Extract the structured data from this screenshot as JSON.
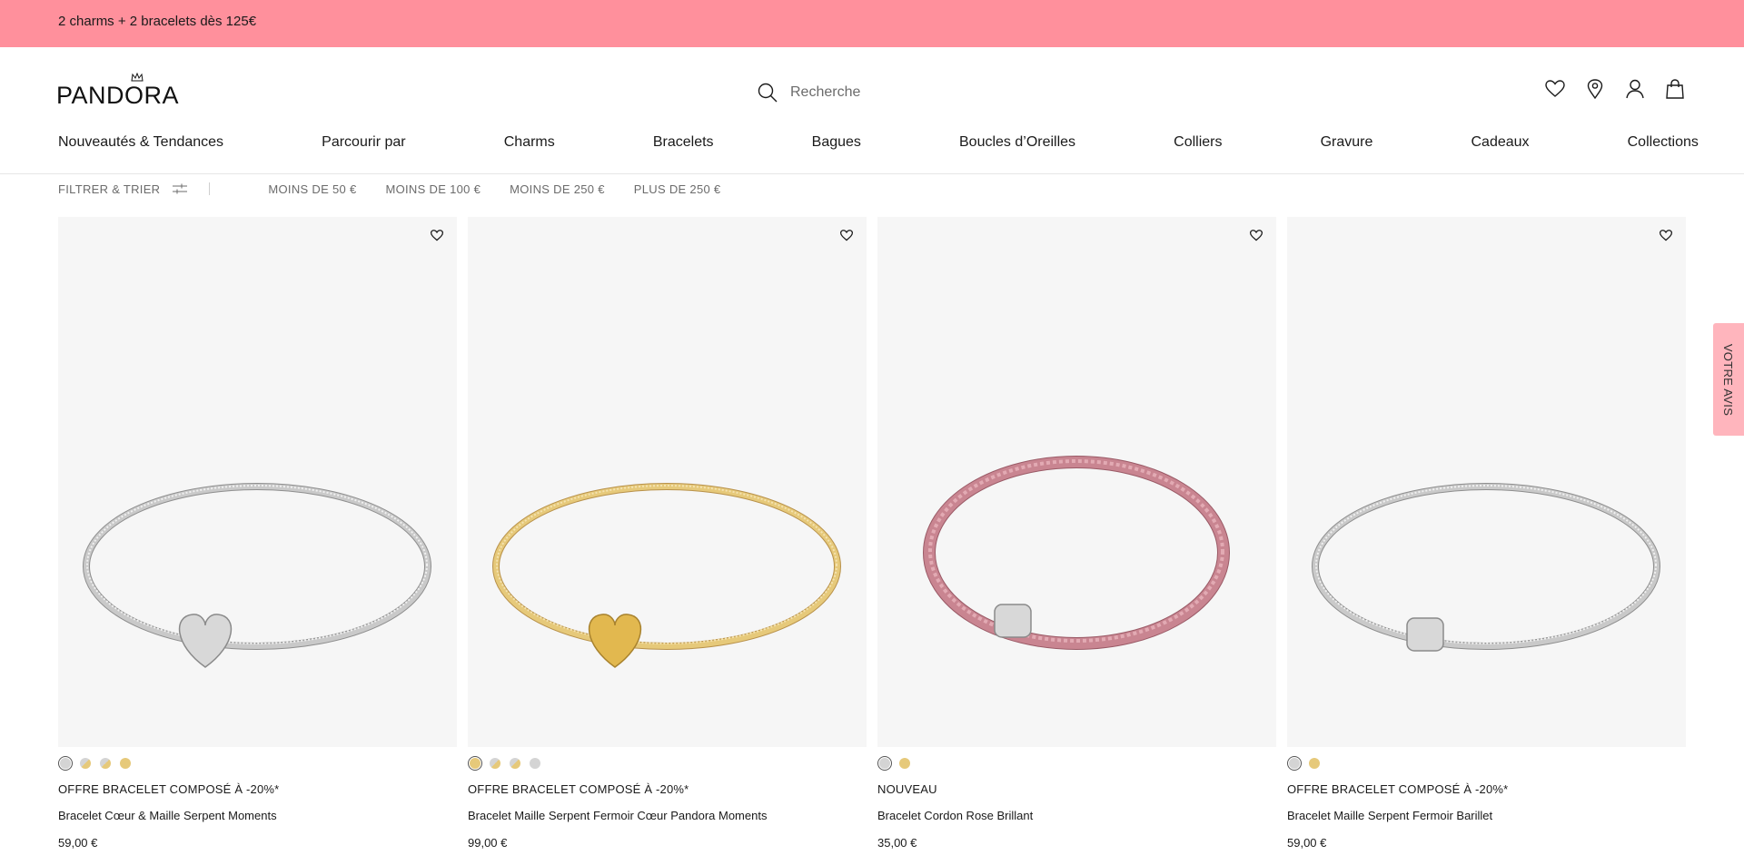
{
  "promo": {
    "text": "2 charms + 2 bracelets dès 125€"
  },
  "brand": {
    "logo_text": "PANDORA"
  },
  "search": {
    "placeholder": "Recherche"
  },
  "header_icons": [
    "heart-icon",
    "location-pin-icon",
    "user-icon",
    "shopping-bag-icon"
  ],
  "nav": {
    "items": [
      "Nouveautés & Tendances",
      "Parcourir par",
      "Charms",
      "Bracelets",
      "Bagues",
      "Boucles d’Oreilles",
      "Colliers",
      "Gravure",
      "Cadeaux",
      "Collections"
    ]
  },
  "filters": {
    "filter_label": "FILTRER & TRIER",
    "chips": [
      "MOINS DE 50 €",
      "MOINS DE 100 €",
      "MOINS DE 250 €",
      "PLUS DE 250 €"
    ]
  },
  "products": [
    {
      "badge": "OFFRE BRACELET COMPOSÉ À -20%*",
      "name": "Bracelet Cœur & Maille Serpent Moments",
      "price": "59,00 €",
      "metal": "silver",
      "clasp": "heart",
      "swatches": [
        "silver",
        "silver-gold",
        "silver-gold",
        "gold"
      ],
      "selected_swatch": 0
    },
    {
      "badge": "OFFRE BRACELET COMPOSÉ À -20%*",
      "name": "Bracelet Maille Serpent Fermoir Cœur Pandora Moments",
      "price": "99,00 €",
      "metal": "gold",
      "clasp": "heart",
      "swatches": [
        "gold",
        "silver-gold",
        "silver-gold",
        "silver"
      ],
      "selected_swatch": 0
    },
    {
      "badge": "NOUVEAU",
      "name": "Bracelet Cordon Rose Brillant",
      "price": "35,00 €",
      "metal": "pink-cord",
      "clasp": "barrel",
      "swatches": [
        "silver",
        "gold"
      ],
      "selected_swatch": 0
    },
    {
      "badge": "OFFRE BRACELET COMPOSÉ À -20%*",
      "name": "Bracelet Maille Serpent Fermoir Barillet",
      "price": "59,00 €",
      "metal": "silver",
      "clasp": "barrel",
      "swatches": [
        "silver",
        "gold"
      ],
      "selected_swatch": 0
    }
  ],
  "feedback": {
    "label": "VOTRE AVIS"
  },
  "colors": {
    "promo_bg": "#ff909c",
    "feedback_bg": "#ffb5bd",
    "card_bg": "#f6f6f6",
    "silver": "#d4d4d4",
    "gold": "#e6c97a",
    "pink_cord": "#c98591"
  }
}
